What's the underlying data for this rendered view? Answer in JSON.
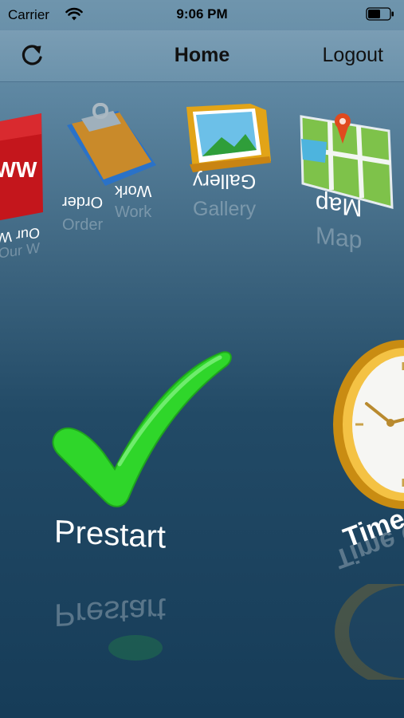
{
  "status_bar": {
    "carrier": "Carrier",
    "time": "9:06 PM"
  },
  "nav": {
    "title": "Home",
    "logout": "Logout",
    "refresh_icon": "refresh-icon"
  },
  "carousel_top": [
    {
      "id": "web",
      "label": "Our W",
      "icon": "web-icon",
      "icon_text": "WW"
    },
    {
      "id": "work-order",
      "label_line1": "Work",
      "label_line2": "Order",
      "icon": "clipboard-icon"
    },
    {
      "id": "gallery",
      "label": "Gallery",
      "icon": "gallery-icon"
    },
    {
      "id": "map",
      "label": "Map",
      "icon": "map-icon"
    }
  ],
  "carousel_main": [
    {
      "id": "prestart",
      "label": "Prestart",
      "icon": "checkmark-icon"
    },
    {
      "id": "time-clock",
      "label": "Time C",
      "icon": "clock-icon"
    }
  ],
  "colors": {
    "background_top": "#6f95ad",
    "background_bottom": "#163c58",
    "check_green": "#2fd62a",
    "web_red": "#c4161c"
  }
}
